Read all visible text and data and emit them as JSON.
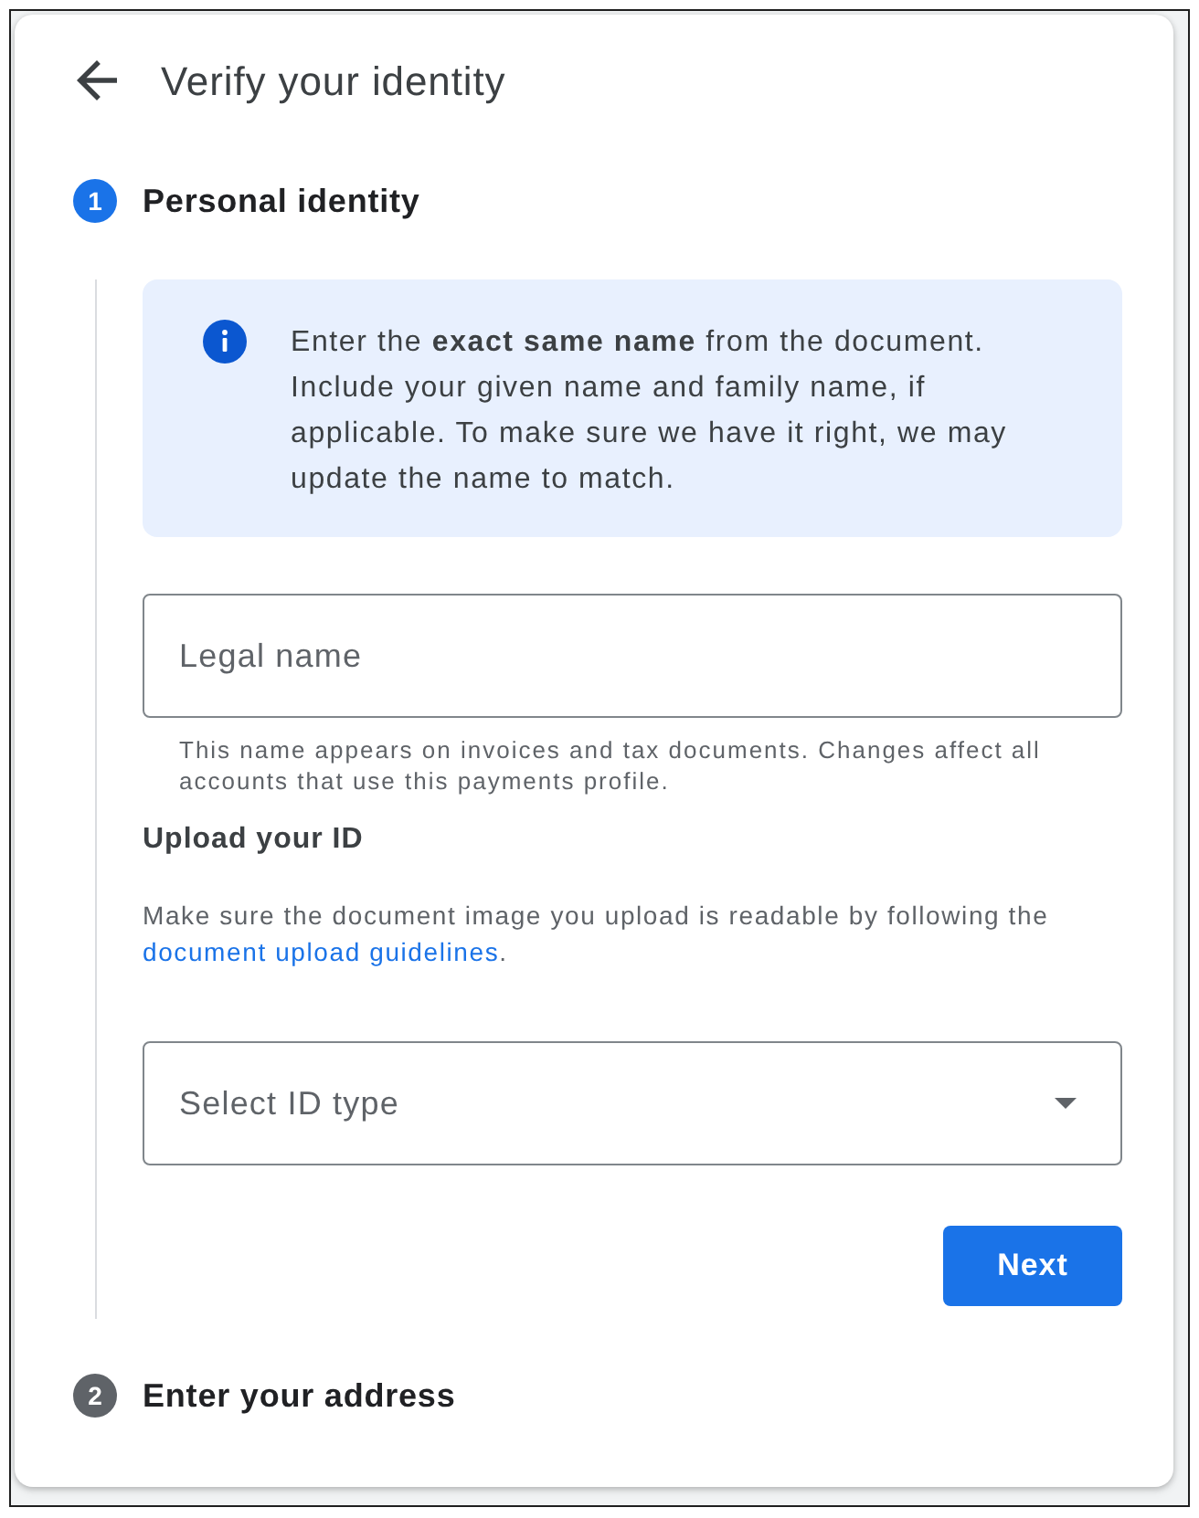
{
  "header": {
    "title": "Verify your identity"
  },
  "steps": [
    {
      "number": "1",
      "title": "Personal identity",
      "selected": true,
      "info": "Enter the **exact same name** from the document. Include your given name and family name, if applicable. To make sure we have it right, we may update the name to match.",
      "legal_name": {
        "placeholder": "Legal name",
        "helper": "This name appears on invoices and tax documents. Changes affect all accounts that use this payments profile."
      },
      "upload": {
        "heading": "Upload your ID",
        "text": "Make sure the document image you upload is readable by following the",
        "link": "document upload guidelines",
        "link_suffix": "."
      },
      "id_type": {
        "placeholder": "Select ID type"
      },
      "button": "Next"
    },
    {
      "number": "2",
      "title": "Enter your address",
      "selected": false
    }
  ]
}
